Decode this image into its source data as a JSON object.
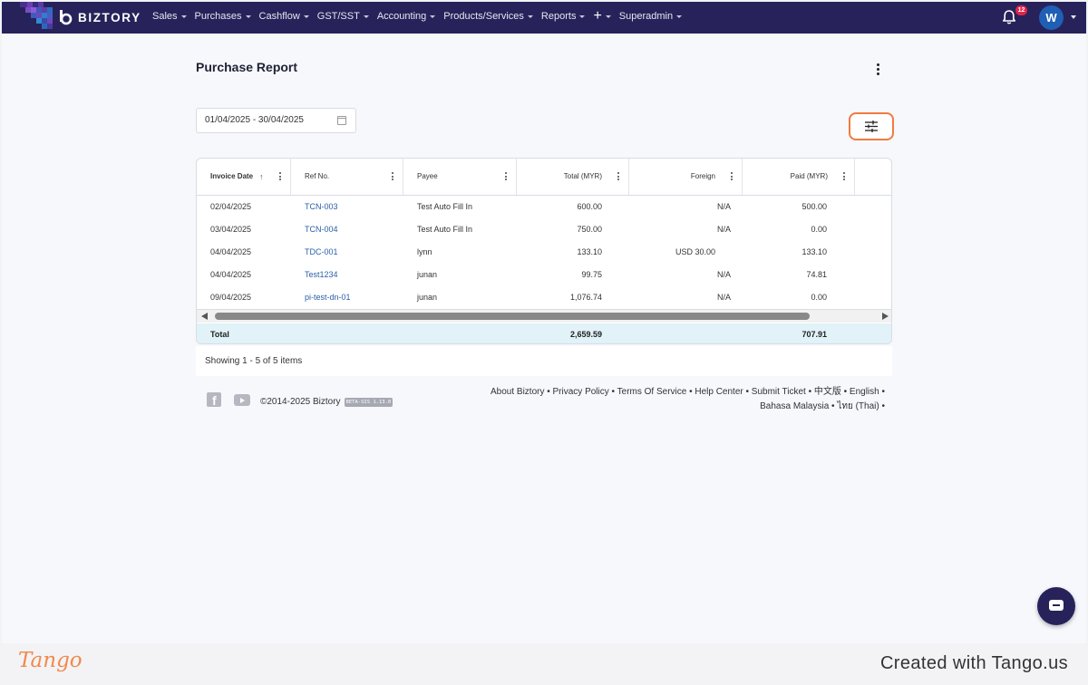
{
  "brand": {
    "name": "BIZTORY"
  },
  "nav": {
    "items": [
      {
        "label": "Sales"
      },
      {
        "label": "Purchases"
      },
      {
        "label": "Cashflow"
      },
      {
        "label": "GST/SST"
      },
      {
        "label": "Accounting"
      },
      {
        "label": "Products/Services"
      },
      {
        "label": "Reports"
      }
    ],
    "plus_label": "+",
    "superadmin_label": "Superadmin",
    "notification_count": "12",
    "avatar_initial": "W"
  },
  "page": {
    "title": "Purchase Report",
    "date_range": "01/04/2025 - 30/04/2025"
  },
  "table": {
    "columns": [
      {
        "label": "Invoice Date",
        "sort": "↑"
      },
      {
        "label": "Ref No."
      },
      {
        "label": "Payee"
      },
      {
        "label": "Total (MYR)"
      },
      {
        "label": "Foreign"
      },
      {
        "label": "Paid (MYR)"
      }
    ],
    "rows": [
      {
        "date": "02/04/2025",
        "ref": "TCN-003",
        "payee": "Test Auto Fill In",
        "total": "600.00",
        "foreign": "N/A",
        "paid": "500.00"
      },
      {
        "date": "03/04/2025",
        "ref": "TCN-004",
        "payee": "Test Auto Fill In",
        "total": "750.00",
        "foreign": "N/A",
        "paid": "0.00"
      },
      {
        "date": "04/04/2025",
        "ref": "TDC-001",
        "payee": "lynn",
        "total": "133.10",
        "foreign": "USD 30.00",
        "paid": "133.10"
      },
      {
        "date": "04/04/2025",
        "ref": "Test1234",
        "payee": "junan",
        "total": "99.75",
        "foreign": "N/A",
        "paid": "74.81"
      },
      {
        "date": "09/04/2025",
        "ref": "pi-test-dn-01",
        "payee": "junan",
        "total": "1,076.74",
        "foreign": "N/A",
        "paid": "0.00"
      }
    ],
    "total": {
      "label": "Total",
      "total": "2,659.59",
      "paid": "707.91"
    },
    "showing": "Showing 1 - 5 of 5 items"
  },
  "footer": {
    "copyright": "©2014-2025 Biztory",
    "version": "BETA-SIS 1.13.0",
    "links_line1": "About Biztory • Privacy Policy • Terms Of Service • Help Center • Submit Ticket • 中文版 • English •",
    "links_line2": "Bahasa Malaysia • ไทย (Thai) •"
  },
  "tango": {
    "logo": "Tango",
    "credit": "Created with Tango.us",
    "accent": "#f08a4b"
  },
  "colors": {
    "navbar": "#27235a",
    "link": "#2a5ea8",
    "highlight": "#f07b3f",
    "total_row": "#e1f2f8"
  },
  "icons": [
    "bell-icon",
    "calendar-icon",
    "filter-sliders-icon",
    "kebab-menu-icon",
    "facebook-icon",
    "youtube-icon",
    "chat-icon",
    "sort-asc-icon"
  ]
}
